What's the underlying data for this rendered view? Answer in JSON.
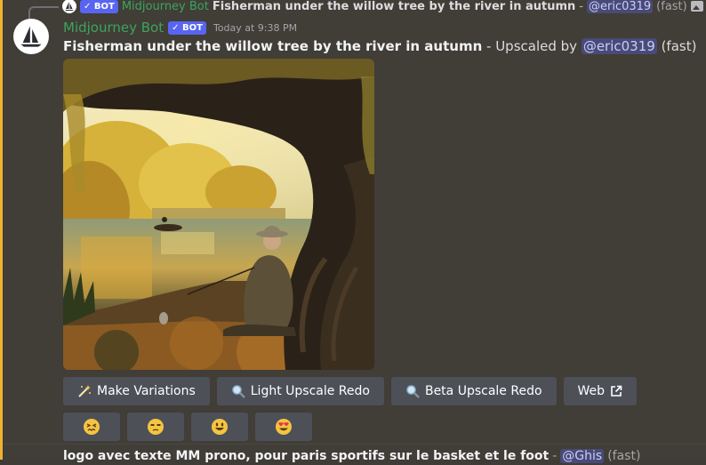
{
  "reply": {
    "bot_badge": "✓ BOT",
    "username": "Midjourney Bot",
    "prompt": "Fisherman under the willow tree by the river in autumn",
    "separator": "-",
    "mention": "@eric0319",
    "mode": "(fast)",
    "attachment_icon": "image-icon"
  },
  "message": {
    "username": "Midjourney Bot",
    "bot_badge": "✓ BOT",
    "timestamp": "Today at 9:38 PM",
    "prompt": "Fisherman under the willow tree by the river in autumn",
    "suffix": " - Upscaled by ",
    "mention": "@eric0319",
    "mode": " (fast)",
    "image_alt": "Fisherman under willow tree by river in autumn"
  },
  "buttons": [
    {
      "label": "Make Variations",
      "icon": "magic-wand-icon"
    },
    {
      "label": "Light Upscale Redo",
      "icon": "magnifier-icon"
    },
    {
      "label": "Beta Upscale Redo",
      "icon": "magnifier-icon"
    },
    {
      "label": "Web",
      "icon": "external-link-icon"
    }
  ],
  "reactions": [
    {
      "name": "confounded-face-emoji"
    },
    {
      "name": "unamused-face-emoji"
    },
    {
      "name": "grinning-face-emoji"
    },
    {
      "name": "heart-eyes-emoji"
    }
  ],
  "next_message": {
    "text": "logo avec texte MM prono, pour paris sportifs sur le basket et le foot",
    "separator": "-",
    "mention": "@Ghis",
    "mode": "(fast)"
  },
  "colors": {
    "background": "#413d37",
    "highlight": "#f0b132",
    "username": "#3ba55c",
    "bot_badge": "#5865f2",
    "button": "#4e5058"
  }
}
